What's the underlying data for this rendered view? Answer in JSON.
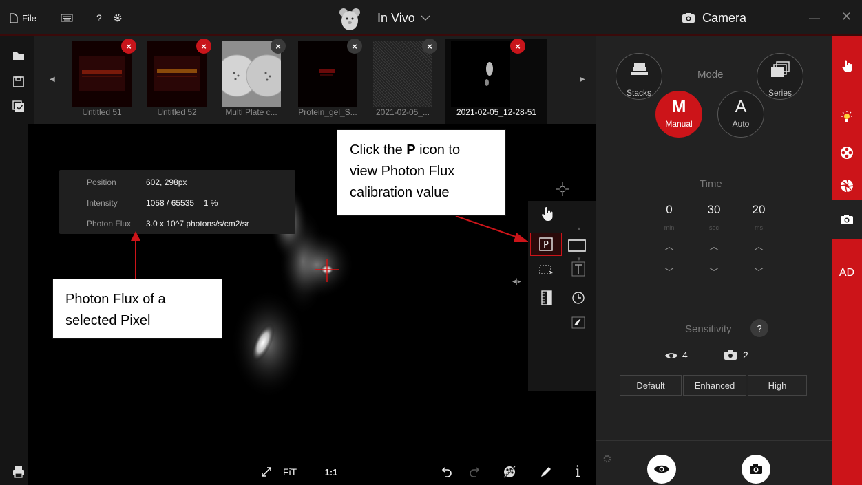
{
  "titlebar": {
    "file_label": "File",
    "help_label": "?",
    "app_mode": "In Vivo",
    "panel_title": "Camera"
  },
  "thumbnails": [
    {
      "label": "Untitled 51",
      "close": "×"
    },
    {
      "label": "Untitled 52",
      "close": "×"
    },
    {
      "label": "Multi Plate c...",
      "close": "×"
    },
    {
      "label": "Protein_gel_S...",
      "close": "×"
    },
    {
      "label": "2021-02-05_...",
      "close": "×"
    },
    {
      "label": "2021-02-05_12-28-51",
      "close": "×"
    }
  ],
  "info": {
    "position_key": "Position",
    "position_val": "602, 298px",
    "intensity_key": "Intensity",
    "intensity_val": "1058 / 65535 = 1 %",
    "flux_key": "Photon Flux",
    "flux_val": "3.0 x 10^7 photons/s/cm2/sr"
  },
  "callouts": {
    "top_line1_a": "Click the ",
    "top_line1_b": "P",
    "top_line1_c": " icon to",
    "top_line2": "view Photon Flux",
    "top_line3": "calibration value",
    "bottom_line1": "Photon Flux of a",
    "bottom_line2": "selected Pixel"
  },
  "bottom_toolbar": {
    "fit": "FiT",
    "one_to_one": "1:1",
    "info": "i"
  },
  "camera": {
    "mode_label": "Mode",
    "stacks": "Stacks",
    "series": "Series",
    "manual_letter": "M",
    "manual_label": "Manual",
    "auto_letter": "A",
    "auto_label": "Auto",
    "time_label": "Time",
    "time_min": "0",
    "time_sec": "30",
    "time_ms": "20",
    "unit_min": "min",
    "unit_sec": "sec",
    "unit_ms": "ms",
    "sensitivity_label": "Sensitivity",
    "sensitivity_help": "?",
    "preview_sensitivity": "4",
    "capture_sensitivity": "2",
    "btn_default": "Default",
    "btn_enhanced": "Enhanced",
    "btn_high": "High"
  },
  "red_sidebar": {
    "ad_label": "AD"
  },
  "colors": {
    "accent_red": "#cc1419",
    "panel_bg": "#222222",
    "view_bg": "#000000"
  }
}
